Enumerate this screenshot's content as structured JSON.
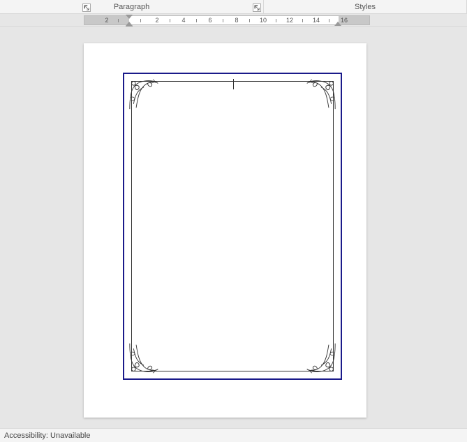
{
  "ribbon": {
    "paragraph_label": "Paragraph",
    "styles_label": "Styles"
  },
  "ruler": {
    "labels": [
      "2",
      "2",
      "4",
      "6",
      "8",
      "10",
      "12",
      "14",
      "16"
    ]
  },
  "status": {
    "accessibility": "Accessibility: Unavailable"
  }
}
